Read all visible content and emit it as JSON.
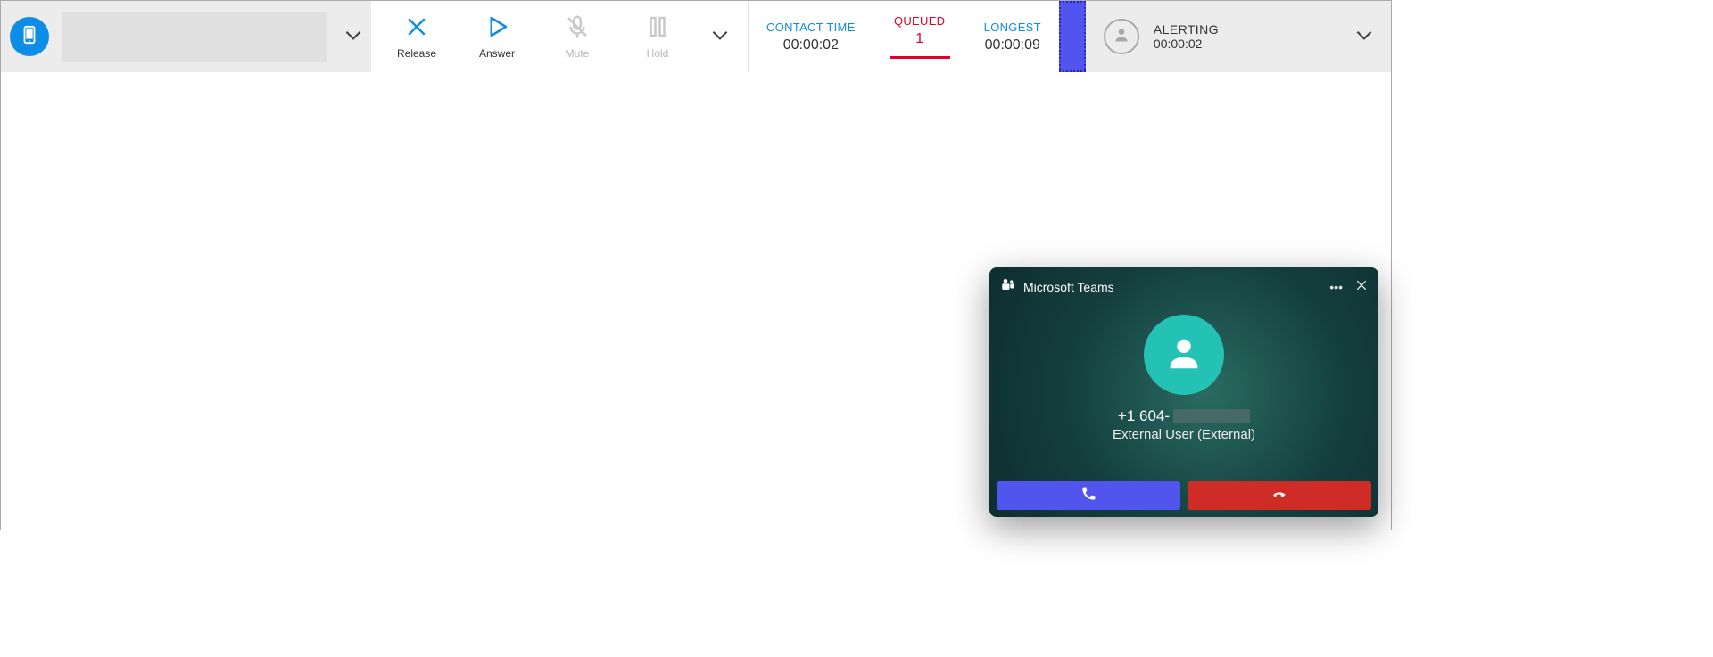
{
  "toolbar": {
    "release_label": "Release",
    "answer_label": "Answer",
    "mute_label": "Mute",
    "hold_label": "Hold"
  },
  "stats": {
    "contact_time_label": "CONTACT TIME",
    "contact_time_val": "00:00:02",
    "queued_label": "QUEUED",
    "queued_val": "1",
    "longest_label": "LONGEST",
    "longest_val": "00:00:09"
  },
  "alert": {
    "title": "ALERTING",
    "time": "00:00:02"
  },
  "teams": {
    "title": "Microsoft Teams",
    "caller_number_prefix": "+1 604-",
    "caller_sub": "External User (External)"
  }
}
